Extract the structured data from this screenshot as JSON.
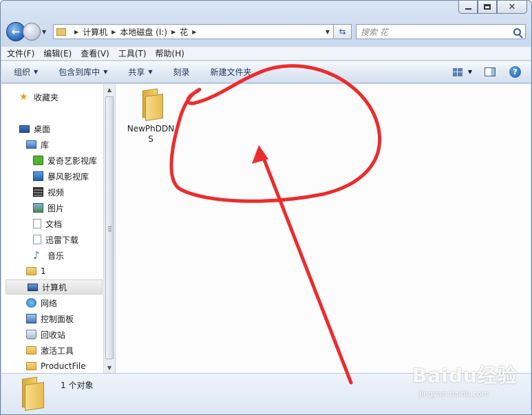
{
  "address": {
    "crumbs": [
      "计算机",
      "本地磁盘 (I:)",
      "花"
    ]
  },
  "search": {
    "placeholder": "搜索 花"
  },
  "menubar": {
    "items": [
      "文件(F)",
      "编辑(E)",
      "查看(V)",
      "工具(T)",
      "帮助(H)"
    ]
  },
  "commands": {
    "organize": "组织",
    "include_library": "包含到库中",
    "share": "共享",
    "burn": "刻录",
    "new_folder": "新建文件夹"
  },
  "nav": {
    "favorites": "收藏夹",
    "desktop": "桌面",
    "libraries": "库",
    "iqiyi": "爱奇艺影视库",
    "baofeng": "暴风影视库",
    "videos": "视频",
    "pictures": "图片",
    "documents": "文档",
    "xunlei": "迅雷下载",
    "music": "音乐",
    "user": "1",
    "computer": "计算机",
    "network": "网络",
    "control_panel": "控制面板",
    "recycle_bin": "回收站",
    "activation": "激活工具",
    "productfile": "ProductFile"
  },
  "files": [
    {
      "name": "NewPhDDNS"
    }
  ],
  "details": {
    "count_text": "1 个对象"
  },
  "watermark": {
    "logo": "Baidu经验",
    "url": "jingyan.baidu.com"
  },
  "colors": {
    "annotation_red": "#ee2b2b",
    "accent_blue": "#2464b7"
  }
}
